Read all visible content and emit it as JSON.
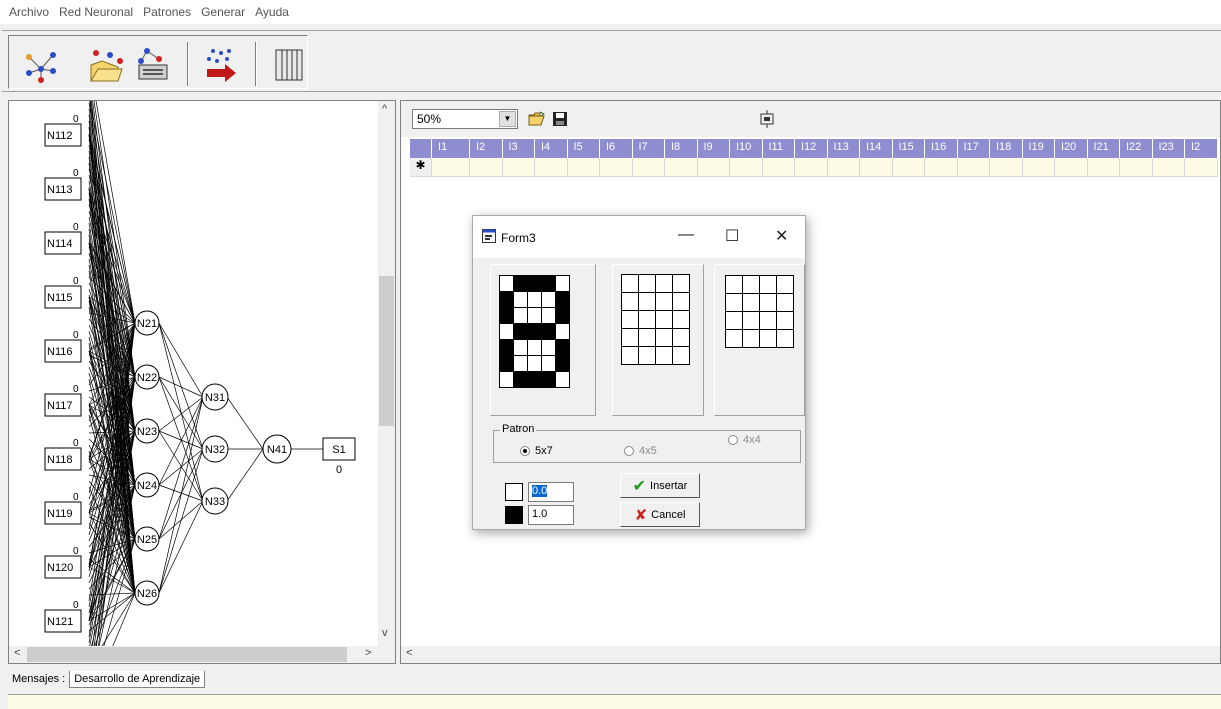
{
  "menu": [
    "Archivo",
    "Red Neuronal",
    "Patrones",
    "Generar",
    "Ayuda"
  ],
  "toolbar": {
    "buttons": [
      {
        "name": "network-icon"
      },
      {
        "name": "open-network-icon"
      },
      {
        "name": "print-network-icon"
      },
      {
        "name": "generate-icon"
      },
      {
        "name": "table-icon"
      }
    ]
  },
  "network": {
    "input_nodes": [
      "N112",
      "N113",
      "N114",
      "N115",
      "N116",
      "N117",
      "N118",
      "N119",
      "N120",
      "N121"
    ],
    "input_values": [
      "0",
      "0",
      "0",
      "0",
      "0",
      "0",
      "0",
      "0",
      "0",
      "0"
    ],
    "hidden1": [
      "N21",
      "N22",
      "N23",
      "N24",
      "N25",
      "N26"
    ],
    "hidden2": [
      "N31",
      "N32",
      "N33"
    ],
    "hidden3": [
      "N41"
    ],
    "output": {
      "label": "S1",
      "value": "0"
    }
  },
  "patterns_panel": {
    "zoom": "50%",
    "columns": [
      "I1",
      "I2",
      "I3",
      "I4",
      "I5",
      "I6",
      "I7",
      "I8",
      "I9",
      "I10",
      "I11",
      "I12",
      "I13",
      "I14",
      "I15",
      "I16",
      "I17",
      "I18",
      "I19",
      "I20",
      "I21",
      "I22",
      "I23",
      "I2"
    ],
    "new_row_marker": "✱"
  },
  "dialog": {
    "title": "Form3",
    "patron_label": "Patron",
    "options": [
      {
        "label": "5x7",
        "selected": true
      },
      {
        "label": "4x5",
        "selected": false
      },
      {
        "label": "4x4",
        "selected": false
      }
    ],
    "white_value": "0.0",
    "black_value": "1.0",
    "insert_label": "Insertar",
    "cancel_label": "Cancel",
    "pattern_5x7": [
      [
        0,
        1,
        1,
        1,
        0
      ],
      [
        1,
        0,
        0,
        0,
        1
      ],
      [
        1,
        0,
        0,
        0,
        1
      ],
      [
        0,
        1,
        1,
        1,
        0
      ],
      [
        1,
        0,
        0,
        0,
        1
      ],
      [
        1,
        0,
        0,
        0,
        1
      ],
      [
        0,
        1,
        1,
        1,
        0
      ]
    ]
  },
  "tabs": {
    "label": "Mensajes :",
    "items": [
      "Desarrollo de Aprendizaje"
    ]
  }
}
